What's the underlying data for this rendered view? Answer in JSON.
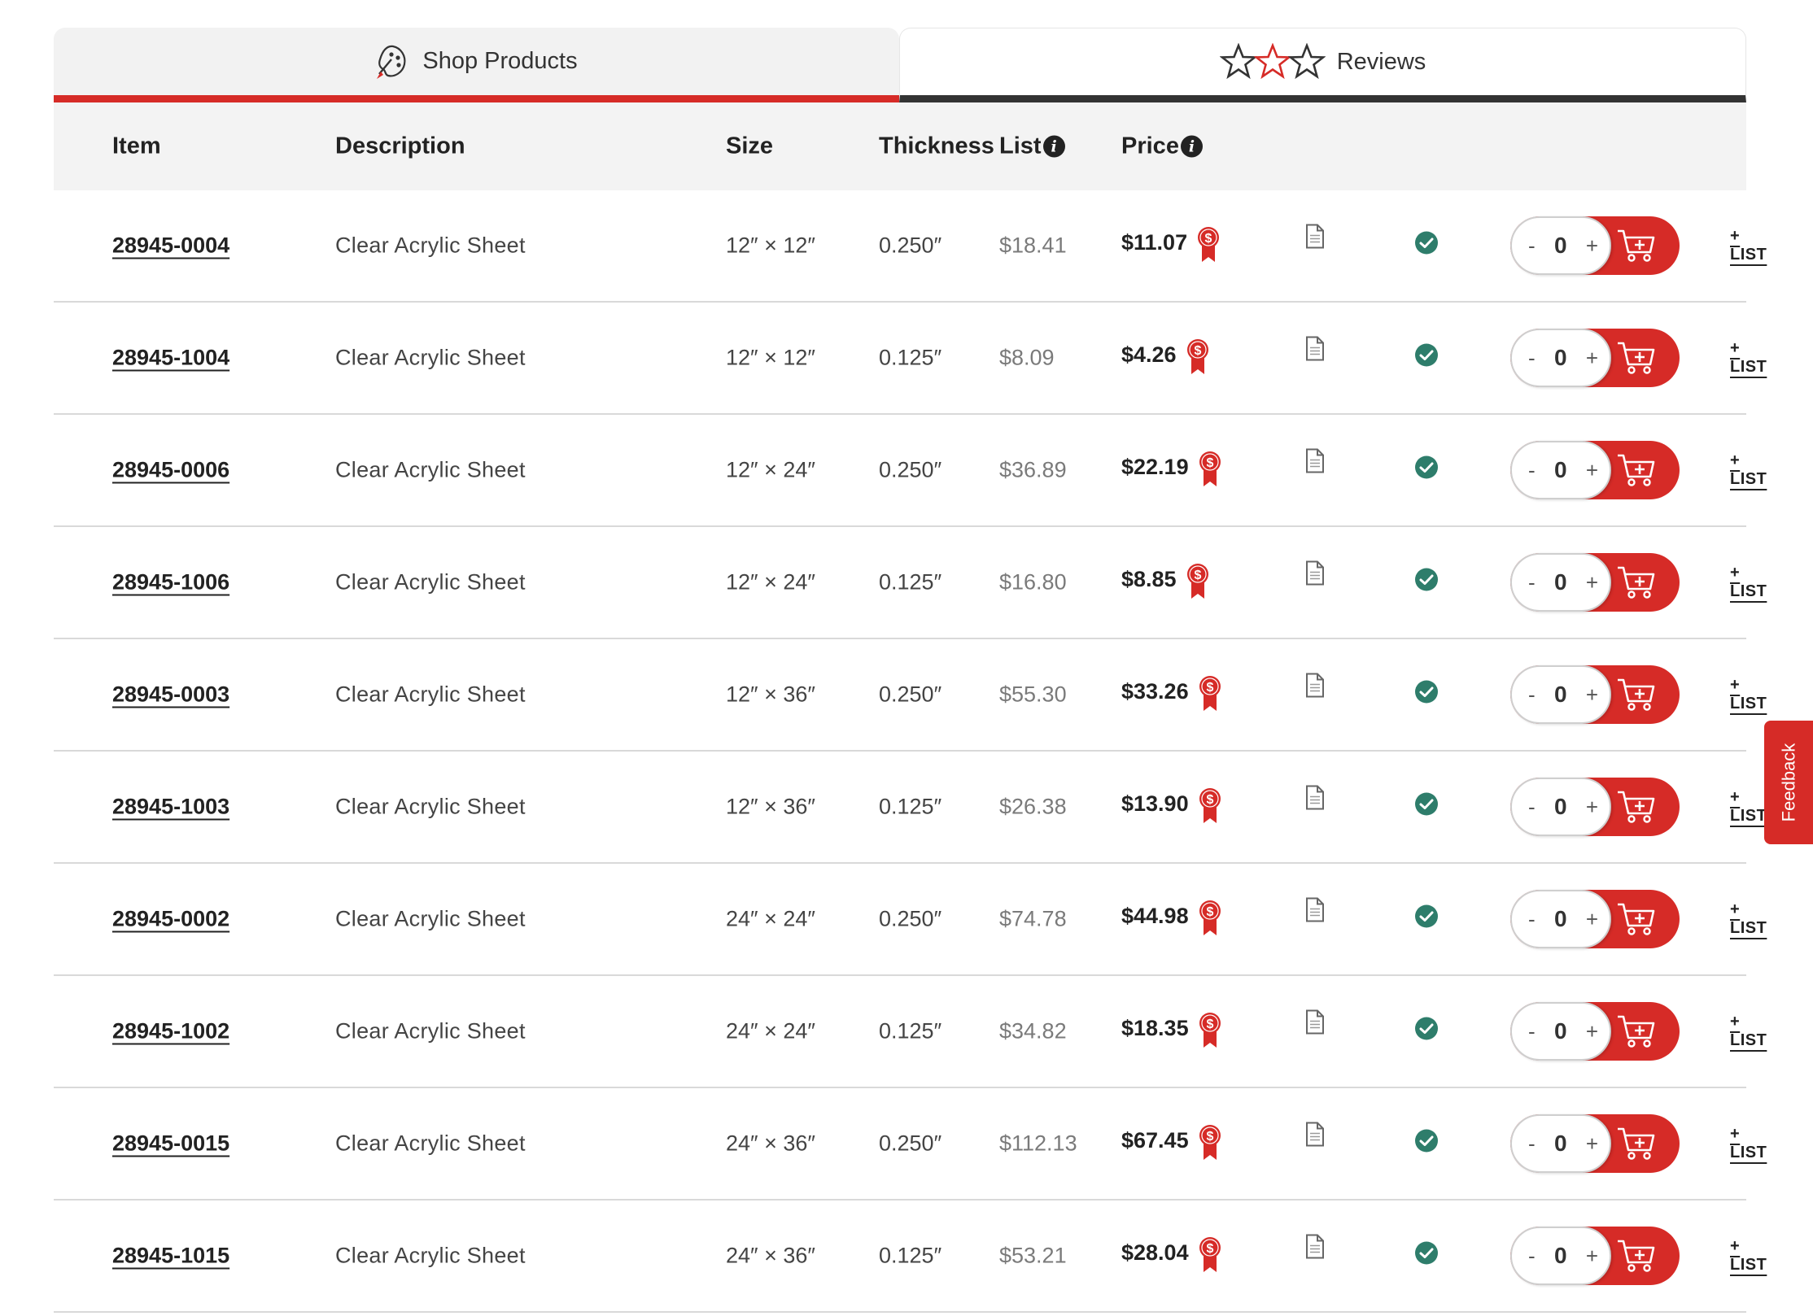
{
  "tabs": {
    "shop": {
      "label": "Shop Products",
      "icon": "paint-palette-icon"
    },
    "reviews": {
      "label": "Reviews",
      "icon": "stars-icon"
    }
  },
  "header": {
    "item": "Item",
    "description": "Description",
    "size": "Size",
    "thickness": "Thickness",
    "list": "List",
    "price": "Price",
    "info_glyph": "i"
  },
  "rows": [
    {
      "item": "28945-0004",
      "description": "Clear Acrylic Sheet",
      "size": "12″ × 12″",
      "thickness": "0.250″",
      "list": "$18.41",
      "price": "$11.07",
      "qty": "0",
      "add_list": "+ LIST"
    },
    {
      "item": "28945-1004",
      "description": "Clear Acrylic Sheet",
      "size": "12″ × 12″",
      "thickness": "0.125″",
      "list": "$8.09",
      "price": "$4.26",
      "qty": "0",
      "add_list": "+ LIST"
    },
    {
      "item": "28945-0006",
      "description": "Clear Acrylic Sheet",
      "size": "12″ × 24″",
      "thickness": "0.250″",
      "list": "$36.89",
      "price": "$22.19",
      "qty": "0",
      "add_list": "+ LIST"
    },
    {
      "item": "28945-1006",
      "description": "Clear Acrylic Sheet",
      "size": "12″ × 24″",
      "thickness": "0.125″",
      "list": "$16.80",
      "price": "$8.85",
      "qty": "0",
      "add_list": "+ LIST"
    },
    {
      "item": "28945-0003",
      "description": "Clear Acrylic Sheet",
      "size": "12″ × 36″",
      "thickness": "0.250″",
      "list": "$55.30",
      "price": "$33.26",
      "qty": "0",
      "add_list": "+ LIST"
    },
    {
      "item": "28945-1003",
      "description": "Clear Acrylic Sheet",
      "size": "12″ × 36″",
      "thickness": "0.125″",
      "list": "$26.38",
      "price": "$13.90",
      "qty": "0",
      "add_list": "+ LIST"
    },
    {
      "item": "28945-0002",
      "description": "Clear Acrylic Sheet",
      "size": "24″ × 24″",
      "thickness": "0.250″",
      "list": "$74.78",
      "price": "$44.98",
      "qty": "0",
      "add_list": "+ LIST"
    },
    {
      "item": "28945-1002",
      "description": "Clear Acrylic Sheet",
      "size": "24″ × 24″",
      "thickness": "0.125″",
      "list": "$34.82",
      "price": "$18.35",
      "qty": "0",
      "add_list": "+ LIST"
    },
    {
      "item": "28945-0015",
      "description": "Clear Acrylic Sheet",
      "size": "24″ × 36″",
      "thickness": "0.250″",
      "list": "$112.13",
      "price": "$67.45",
      "qty": "0",
      "add_list": "+ LIST"
    },
    {
      "item": "28945-1015",
      "description": "Clear Acrylic Sheet",
      "size": "24″ × 36″",
      "thickness": "0.125″",
      "list": "$53.21",
      "price": "$28.04",
      "qty": "0",
      "add_list": "+ LIST"
    }
  ],
  "stepper": {
    "minus": "-",
    "plus": "+"
  },
  "feedback": {
    "label": "Feedback"
  },
  "colors": {
    "accent": "#d62b27",
    "dark": "#333333",
    "check": "#2e7d6b",
    "header_bg": "#f3f3f3"
  }
}
